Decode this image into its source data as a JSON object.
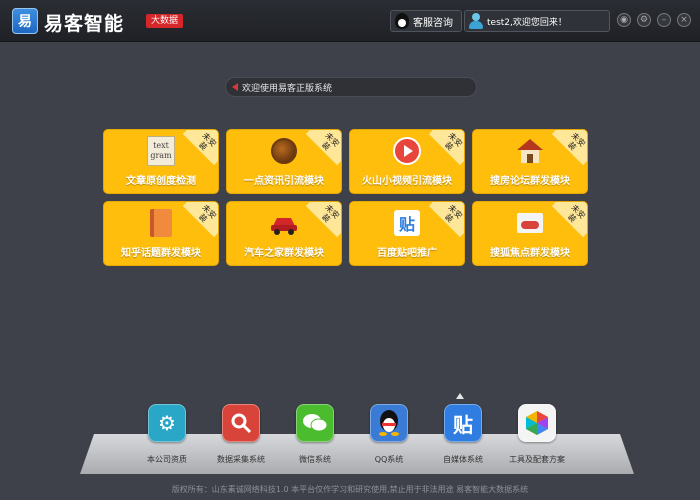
{
  "titlebar": {
    "logo_char": "易",
    "app_title": "易客智能",
    "badge": "大数据",
    "service_label": "客服咨询",
    "user_greeting": "test2,欢迎您回来！"
  },
  "welcome": {
    "text": "欢迎使用易客正版系统"
  },
  "tiles": [
    {
      "label": "文章原创度检测",
      "corner": "未安装",
      "icon": "text-gram-icon"
    },
    {
      "label": "一点资讯引流模块",
      "corner": "未安装",
      "icon": "ydzx-icon"
    },
    {
      "label": "火山小视频引流模块",
      "corner": "未安装",
      "icon": "video-play-icon"
    },
    {
      "label": "搜房论坛群发模块",
      "corner": "未安装",
      "icon": "house-icon"
    },
    {
      "label": "知乎话题群发模块",
      "corner": "未安装",
      "icon": "notebook-icon"
    },
    {
      "label": "汽车之家群发模块",
      "corner": "未安装",
      "icon": "car-icon"
    },
    {
      "label": "百度贴吧推广",
      "corner": "未安装",
      "icon": "tieba-icon"
    },
    {
      "label": "搜狐焦点群发模块",
      "corner": "未安装",
      "icon": "sohu-icon"
    }
  ],
  "tile_text_sample": "text gram",
  "tieba_char": "贴",
  "dock": [
    {
      "label": "本公司资质",
      "icon": "gear-icon",
      "color": "#2aa7c7"
    },
    {
      "label": "数据采集系统",
      "icon": "magnifier-icon",
      "color": "#d9443a"
    },
    {
      "label": "微信系统",
      "icon": "wechat-icon",
      "color": "#4cbc2f"
    },
    {
      "label": "QQ系统",
      "icon": "qq-icon",
      "color": "#3a7bd5"
    },
    {
      "label": "自媒体系统",
      "icon": "tieba-icon",
      "color": "#2f7de0"
    },
    {
      "label": "工具及配套方案",
      "icon": "hexagon-icon",
      "color": "#f4f4f4"
    }
  ],
  "footer": {
    "text": "版权所有：山东素诚网络科技1.0 本平台仅作学习和研究使用,禁止用于非法用途 易客智能大数据系统"
  }
}
